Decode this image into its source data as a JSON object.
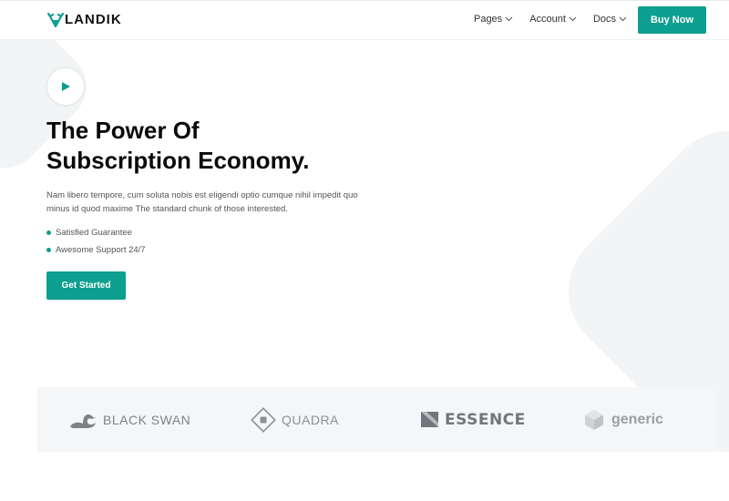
{
  "header": {
    "logo_text": "LANDIK",
    "nav": [
      {
        "label": "Pages"
      },
      {
        "label": "Account"
      },
      {
        "label": "Docs"
      }
    ],
    "buy_label": "Buy Now"
  },
  "hero": {
    "title_line1": "The Power Of",
    "title_line2": "Subscription Economy.",
    "description": "Nam libero tempore, cum soluta nobis est eligendi optio cumque nihil impedit quo minus id quod maxime The standard chunk of those interested.",
    "bullets": [
      "Satisfied Guarantee",
      "Awesome Support 24/7"
    ],
    "cta_label": "Get Started"
  },
  "brands": [
    {
      "name": "BLACK SWAN",
      "icon": "swan-icon"
    },
    {
      "name": "QUADRA",
      "icon": "quadra-diamond-icon"
    },
    {
      "name": "ESSENCE",
      "icon": "essence-square-icon"
    },
    {
      "name": "generic",
      "icon": "cube-icon"
    }
  ],
  "colors": {
    "accent": "#0d9f8f",
    "background_shape": "#f3f4f5",
    "brand_strip": "#f5f6f7"
  }
}
